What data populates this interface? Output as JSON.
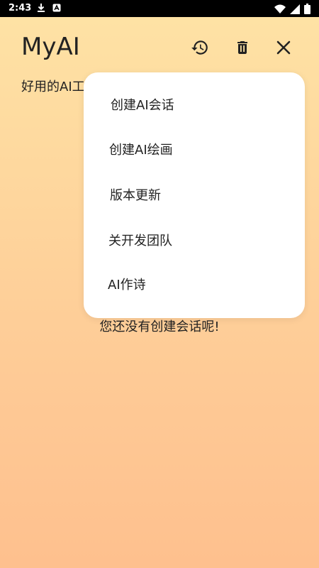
{
  "status_bar": {
    "time": "2:43",
    "icons": [
      "download-icon",
      "app-notification-icon",
      "wifi-icon",
      "signal-icon",
      "battery-icon"
    ]
  },
  "header": {
    "title": "MyAI",
    "subtitle": "好用的AI工",
    "icons": [
      "history-icon",
      "delete-icon",
      "close-icon"
    ]
  },
  "main": {
    "empty_message": "您还没有创建会话呢!"
  },
  "menu": {
    "items": [
      {
        "label": "创建AI会话"
      },
      {
        "label": "创建AI绘画"
      },
      {
        "label": "版本更新"
      },
      {
        "label": "关开发团队"
      },
      {
        "label": "AI作诗"
      }
    ]
  },
  "colors": {
    "gradient_top": "#fee3a5",
    "gradient_bottom": "#fec08e",
    "menu_background": "#ffffff",
    "text": "#222222",
    "status_bar": "#000000"
  }
}
